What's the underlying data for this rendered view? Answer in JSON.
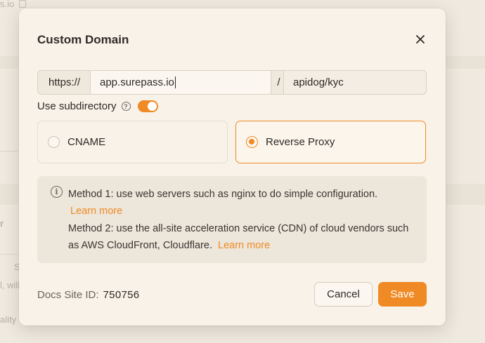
{
  "background": {
    "fragment_top": "s.io",
    "fragment_r": "r",
    "fragment_s": "S",
    "fragment_will": "l, will",
    "fragment_ality": "ality"
  },
  "dialog": {
    "title": "Custom Domain",
    "close_icon": "close-icon",
    "url": {
      "protocol": "https://",
      "host": "app.surepass.io",
      "separator": "/",
      "path": "apidog/kyc"
    },
    "subdirectory": {
      "label": "Use subdirectory",
      "help_icon": "question-circle-icon",
      "enabled": true
    },
    "options": [
      {
        "label": "CNAME",
        "selected": false
      },
      {
        "label": "Reverse Proxy",
        "selected": true
      }
    ],
    "info": {
      "icon": "info-circle-icon",
      "method1_text": "Method 1: use web servers such as nginx to do simple configuration.",
      "method1_link": "Learn more",
      "method2_text": "Method 2: use the all-site acceleration service (CDN) of cloud vendors such as AWS CloudFront, Cloudflare.",
      "method2_link": "Learn more"
    },
    "footer": {
      "docs_id_label": "Docs Site ID:",
      "docs_id_value": "750756",
      "cancel_label": "Cancel",
      "save_label": "Save"
    }
  },
  "colors": {
    "accent": "#f08a24",
    "dialog_bg": "#f8f2e8"
  }
}
